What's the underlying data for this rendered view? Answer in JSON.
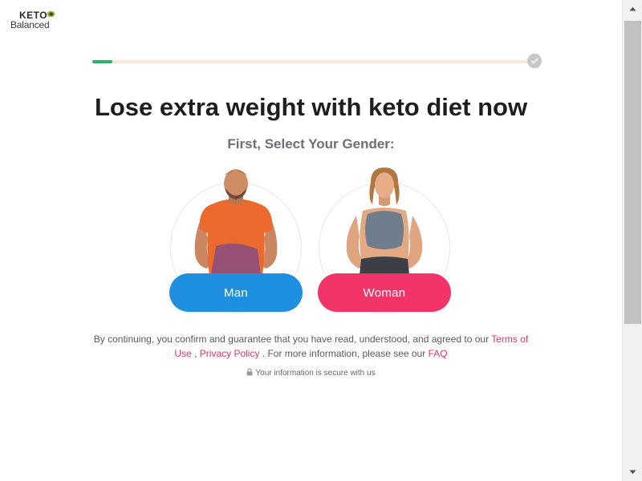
{
  "brand": {
    "line1": "KETO",
    "line2": "Balanced",
    "icon": "avocado-leaf-icon"
  },
  "progress": {
    "value_percent": 4.6,
    "end_icon": "check-icon",
    "fill_color": "#2cb36b",
    "track_color": "#f6eadb"
  },
  "headline": "Lose extra weight with keto diet now",
  "subheadline": "First, Select Your Gender:",
  "options": [
    {
      "label": "Man",
      "color": "#1f8fdf"
    },
    {
      "label": "Woman",
      "color": "#f33468"
    }
  ],
  "legal": {
    "text1": "By continuing, you confirm and guarantee that you have read, understood, and agreed to our ",
    "terms_link": "Terms of Use",
    "sep": " , ",
    "privacy_link": "Privacy Policy",
    "text2": " . For more information, please see our ",
    "faq_link": "FAQ"
  },
  "secure_note": "Your information is secure with us",
  "secure_icon": "lock-icon"
}
